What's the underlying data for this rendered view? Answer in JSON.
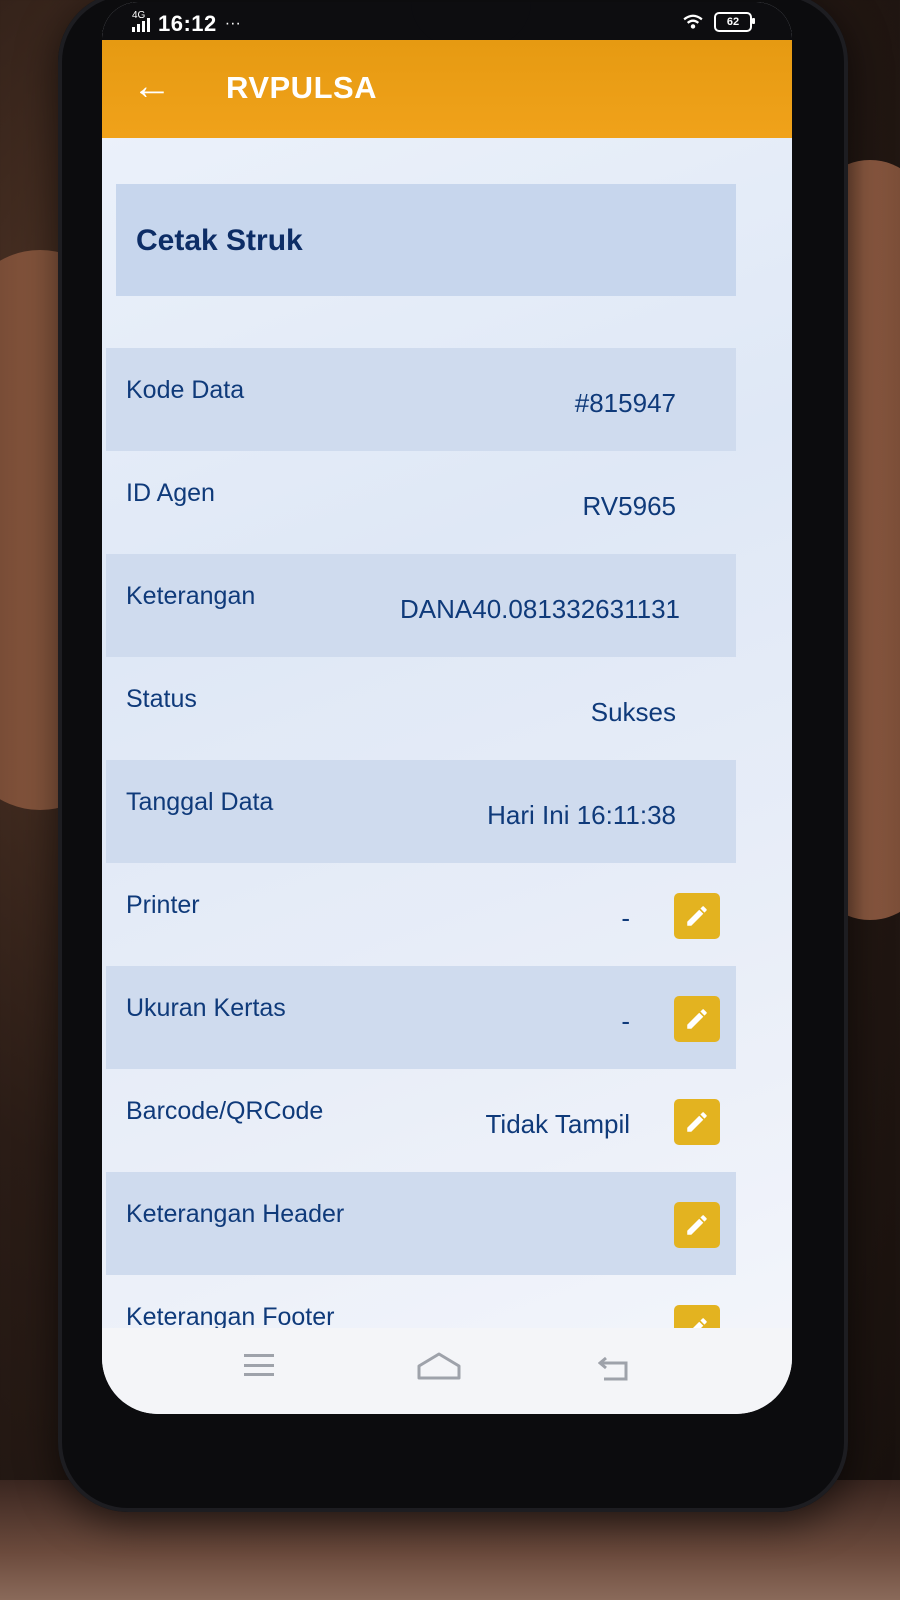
{
  "status_bar": {
    "network": "4G",
    "time": "16:12",
    "more": "···",
    "battery": "62"
  },
  "app_bar": {
    "back_icon": "arrow-left-icon",
    "title": "RVPULSA"
  },
  "section_title": "Cetak Struk",
  "rows": [
    {
      "label": "Kode Data",
      "value": "#815947"
    },
    {
      "label": "ID Agen",
      "value": "RV5965"
    },
    {
      "label": "Keterangan",
      "value": "DANA40.081332631131"
    },
    {
      "label": "Status",
      "value": "Sukses"
    },
    {
      "label": "Tanggal Data",
      "value": "Hari Ini 16:11:38"
    },
    {
      "label": "Printer",
      "value": "-",
      "editable": true
    },
    {
      "label": "Ukuran Kertas",
      "value": "-",
      "editable": true
    },
    {
      "label": "Barcode/QRCode",
      "value": "Tidak Tampil",
      "editable": true
    },
    {
      "label": "Keterangan Header",
      "value": "",
      "editable": true
    },
    {
      "label": "Keterangan Footer",
      "value": "",
      "editable": true
    }
  ],
  "nav_bar": {
    "menu_icon": "menu-icon",
    "home_icon": "home-icon",
    "back_icon": "back-icon"
  },
  "colors": {
    "app_bar": "#f0a21a",
    "edit_button": "#e3b320",
    "text": "#0f3a7a",
    "shaded_row": "#cfdbee"
  }
}
